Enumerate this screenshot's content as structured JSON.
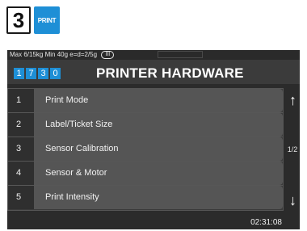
{
  "top_keys": {
    "step_number": "3",
    "print_key_label": "PRINT"
  },
  "status_bar": {
    "capacity_text": "Max 6/15kg Min 40g e=d=2/5g",
    "range_badge": "III"
  },
  "header": {
    "code_digits": [
      "1",
      "7",
      "3",
      "0"
    ],
    "title": "PRINTER HARDWARE"
  },
  "menu": {
    "items": [
      {
        "number": "1",
        "label": "Print Mode"
      },
      {
        "number": "2",
        "label": "Label/Ticket Size"
      },
      {
        "number": "3",
        "label": "Sensor Calibration"
      },
      {
        "number": "4",
        "label": "Sensor & Motor"
      },
      {
        "number": "5",
        "label": "Print Intensity"
      }
    ]
  },
  "navigation": {
    "up_icon": "arrow-up-icon",
    "down_icon": "arrow-down-icon",
    "page_indicator": "1/2"
  },
  "footer": {
    "time": "02:31:08"
  },
  "colors": {
    "accent_blue": "#1e8fd6",
    "screen_bg": "#2b2b2b",
    "item_bg": "#555555"
  }
}
